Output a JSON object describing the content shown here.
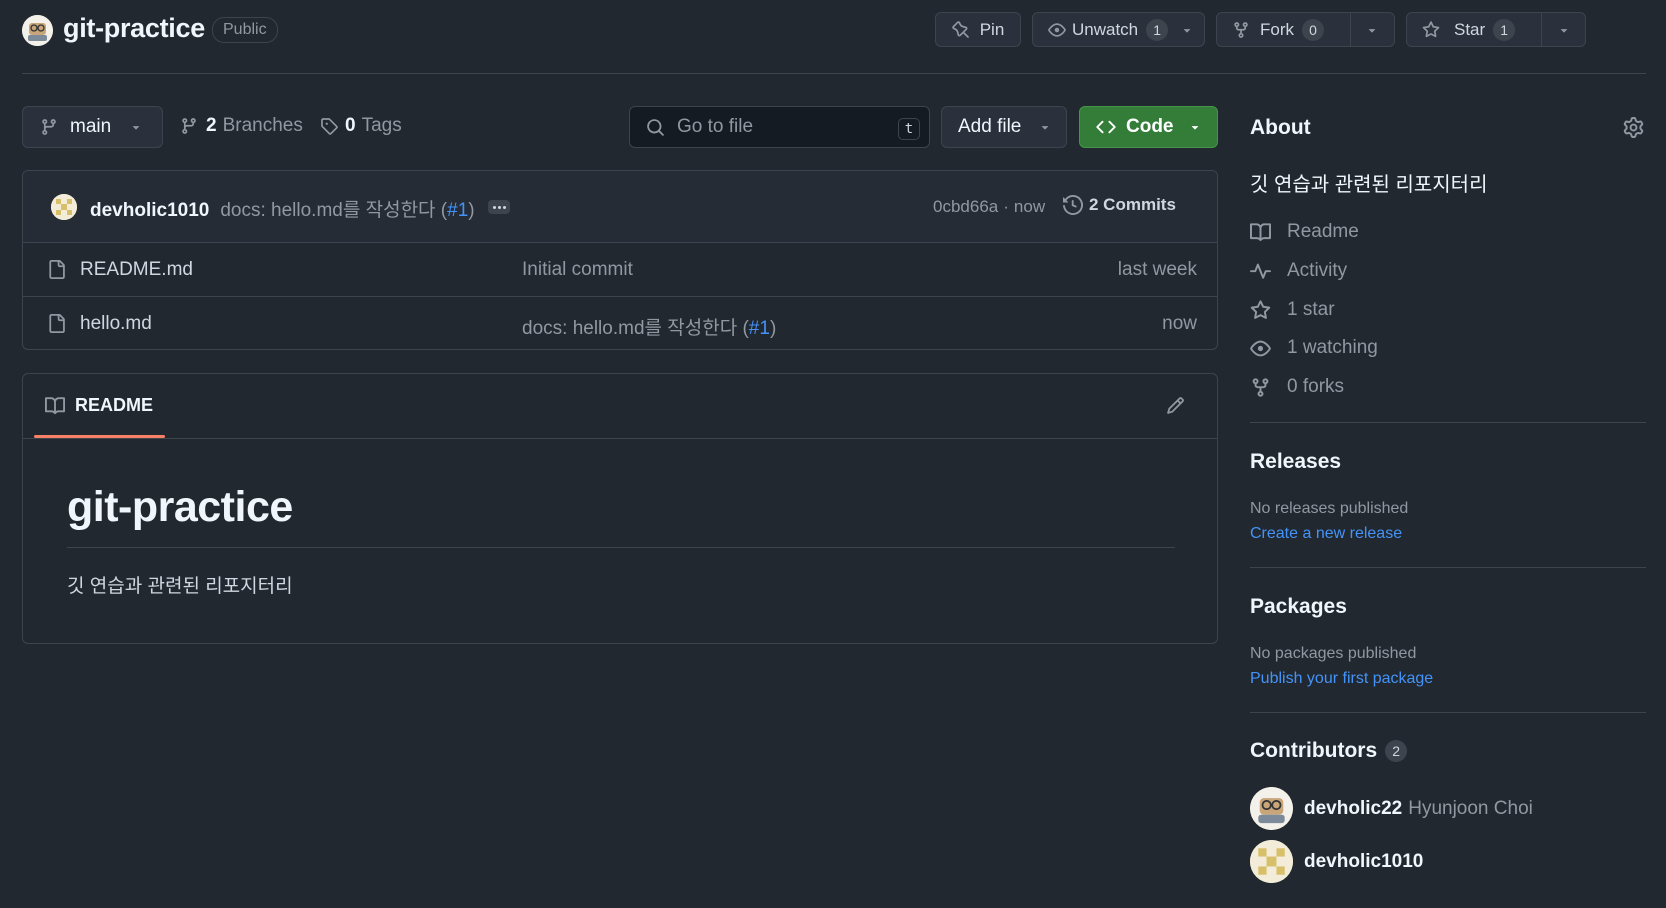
{
  "repo": {
    "name": "git-practice",
    "visibility": "Public"
  },
  "header_actions": {
    "pin": "Pin",
    "unwatch": "Unwatch",
    "unwatch_count": "1",
    "fork": "Fork",
    "fork_count": "0",
    "star": "Star",
    "star_count": "1"
  },
  "toolbar": {
    "branch": "main",
    "branches_count": "2",
    "branches_label": "Branches",
    "tags_count": "0",
    "tags_label": "Tags",
    "search_placeholder": "Go to file",
    "search_shortcut": "t",
    "add_file": "Add file",
    "code": "Code"
  },
  "latest_commit": {
    "author": "devholic1010",
    "message": "docs: hello.md를 작성한다 (",
    "pr": "#1",
    "message_end": ")",
    "hash": "0cbd66a",
    "separator": "·",
    "time": "now",
    "commits_label": "2 Commits"
  },
  "files": [
    {
      "name": "README.md",
      "message": "Initial commit",
      "time": "last week"
    },
    {
      "name": "hello.md",
      "message": "docs: hello.md를 작성한다 (",
      "pr": "#1",
      "message_end": ")",
      "time": "now"
    }
  ],
  "readme": {
    "tab": "README",
    "title": "git-practice",
    "body": "깃 연습과 관련된 리포지터리"
  },
  "about": {
    "title": "About",
    "description": "깃 연습과 관련된 리포지터리",
    "items": [
      "Readme",
      "Activity",
      "1 star",
      "1 watching",
      "0 forks"
    ]
  },
  "releases": {
    "title": "Releases",
    "none": "No releases published",
    "link": "Create a new release"
  },
  "packages": {
    "title": "Packages",
    "none": "No packages published",
    "link": "Publish your first package"
  },
  "contributors": {
    "title": "Contributors",
    "count": "2",
    "list": [
      {
        "login": "devholic22",
        "name": "Hyunjoon Choi"
      },
      {
        "login": "devholic1010",
        "name": ""
      }
    ]
  },
  "colors": {
    "background": "#212830",
    "border": "#3d444d",
    "link": "#4493f8",
    "code_button": "#347d39",
    "tab_underline": "#f78166"
  }
}
